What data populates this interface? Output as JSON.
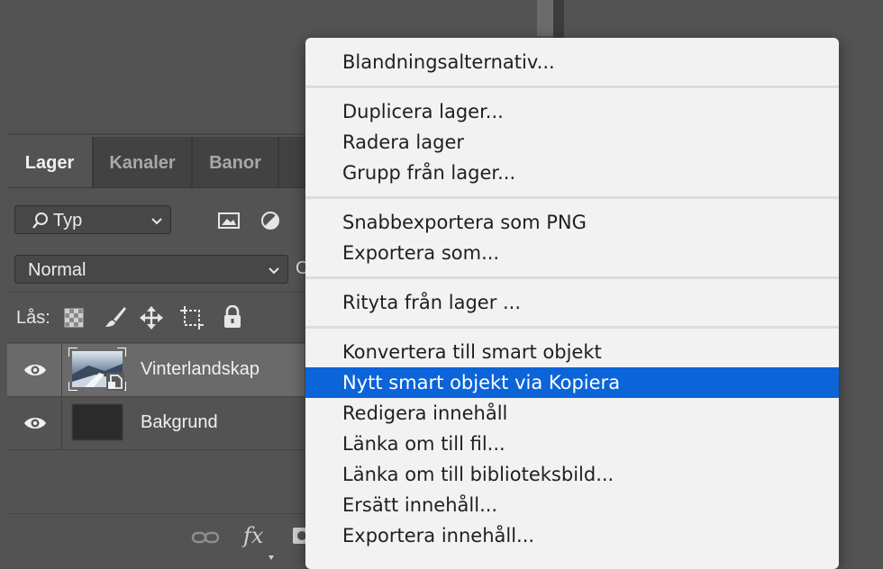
{
  "panel": {
    "tabs": [
      {
        "label": "Lager",
        "active": true
      },
      {
        "label": "Kanaler",
        "active": false
      },
      {
        "label": "Banor",
        "active": false
      }
    ],
    "filter": {
      "selected": "Typ",
      "icon": "search-icon"
    },
    "blend_mode": "Normal",
    "opacity_label_partial": "O",
    "lock_label": "Lås:",
    "layers": [
      {
        "name": "Vinterlandskap",
        "visible": true,
        "selected": true,
        "smart_object": true
      },
      {
        "name": "Bakgrund",
        "visible": true,
        "selected": false,
        "smart_object": false
      }
    ],
    "bottom": {
      "fx_label": "fx"
    }
  },
  "menu": {
    "groups": [
      [
        "Blandningsalternativ..."
      ],
      [
        "Duplicera lager...",
        "Radera lager",
        "Grupp från lager..."
      ],
      [
        "Snabbexportera som PNG",
        "Exportera som..."
      ],
      [
        "Rityta från lager ..."
      ],
      [
        "Konvertera till smart objekt",
        "Nytt smart objekt via Kopiera",
        "Redigera innehåll",
        "Länka om till fil...",
        "Länka om till biblioteksbild...",
        "Ersätt innehåll...",
        "Exportera innehåll..."
      ]
    ],
    "highlighted": "Nytt smart objekt via Kopiera",
    "colors": {
      "highlight": "#0c64d9",
      "background": "#f2f2f2"
    }
  },
  "colors": {
    "app_bg": "#535353",
    "tab_bar": "#424242",
    "selected_row": "#6a6a6a"
  }
}
